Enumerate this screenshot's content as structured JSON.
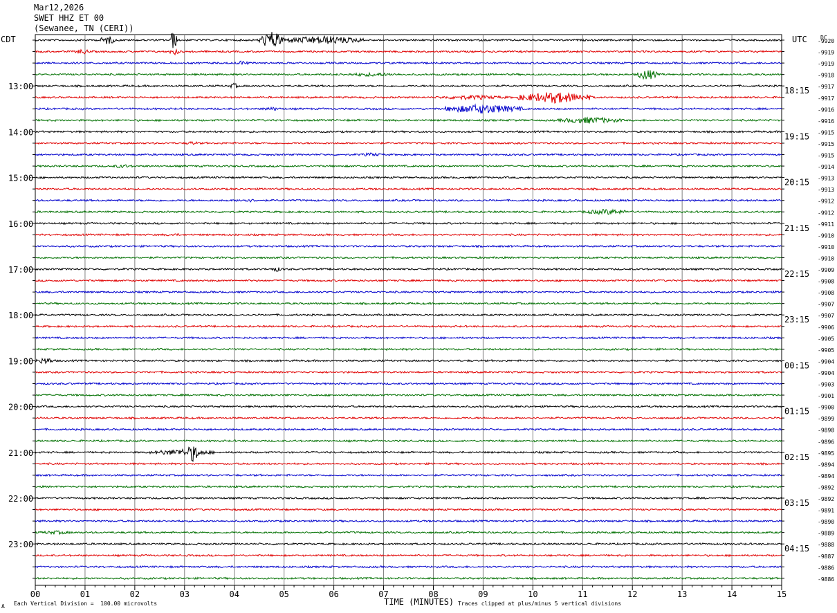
{
  "header": {
    "date": "Mar12,2026",
    "station": "SWET HHZ ET 00",
    "location": "(Sewanee, TN (CERI))"
  },
  "left_zone": "CDT",
  "right_zone": "UTC",
  "dc_label": "DC",
  "footer": {
    "scale_note": "Each Vertical Division =  100.00 microvolts",
    "clip_note": "Traces clipped at plus/minus 5 vertical divisions",
    "corner_mark": "A"
  },
  "colors": {
    "trace_cycle": [
      "#000000",
      "#e00000",
      "#0000cc",
      "#007000"
    ],
    "grid": "#808080"
  },
  "chart_data": {
    "type": "line",
    "title": "SWET HHZ ET 00",
    "xlabel": "TIME (MINUTES)",
    "ylabel": "",
    "xlim": [
      0,
      15
    ],
    "x_ticks": [
      "00",
      "01",
      "02",
      "03",
      "04",
      "05",
      "06",
      "07",
      "08",
      "09",
      "10",
      "11",
      "12",
      "13",
      "14",
      "15"
    ],
    "trace_count": 48,
    "left_hour_labels": [
      {
        "trace": 4,
        "label": "13:00"
      },
      {
        "trace": 8,
        "label": "14:00"
      },
      {
        "trace": 12,
        "label": "15:00"
      },
      {
        "trace": 16,
        "label": "16:00"
      },
      {
        "trace": 20,
        "label": "17:00"
      },
      {
        "trace": 24,
        "label": "18:00"
      },
      {
        "trace": 28,
        "label": "19:00"
      },
      {
        "trace": 32,
        "label": "20:00"
      },
      {
        "trace": 36,
        "label": "21:00"
      },
      {
        "trace": 40,
        "label": "22:00"
      },
      {
        "trace": 44,
        "label": "23:00"
      }
    ],
    "right_hour_labels": [
      {
        "trace": 4,
        "label": "18:15"
      },
      {
        "trace": 8,
        "label": "19:15"
      },
      {
        "trace": 12,
        "label": "20:15"
      },
      {
        "trace": 16,
        "label": "21:15"
      },
      {
        "trace": 20,
        "label": "22:15"
      },
      {
        "trace": 24,
        "label": "23:15"
      },
      {
        "trace": 28,
        "label": "00:15"
      },
      {
        "trace": 32,
        "label": "01:15"
      },
      {
        "trace": 36,
        "label": "02:15"
      },
      {
        "trace": 40,
        "label": "03:15"
      },
      {
        "trace": 44,
        "label": "04:15"
      }
    ],
    "dc_offsets": [
      "-9920",
      "-9919",
      "-9919",
      "-9918",
      "-9917",
      "-9917",
      "-9916",
      "-9916",
      "-9915",
      "-9915",
      "-9915",
      "-9914",
      "-9913",
      "-9913",
      "-9912",
      "-9912",
      "-9911",
      "-9910",
      "-9910",
      "-9910",
      "-9909",
      "-9908",
      "-9908",
      "-9907",
      "-9907",
      "-9906",
      "-9905",
      "-9905",
      "-9904",
      "-9904",
      "-9903",
      "-9901",
      "-9900",
      "-9899",
      "-9898",
      "-9896",
      "-9895",
      "-9894",
      "-9894",
      "-9892",
      "-9892",
      "-9891",
      "-9890",
      "-9889",
      "-9888",
      "-9887",
      "-9886",
      "-9886"
    ],
    "events": [
      {
        "trace": 0,
        "start_min": 1.3,
        "end_min": 1.6,
        "amp": 0.5
      },
      {
        "trace": 0,
        "start_min": 2.7,
        "end_min": 2.85,
        "amp": 1.0
      },
      {
        "trace": 0,
        "start_min": 4.5,
        "end_min": 5.0,
        "amp": 0.9
      },
      {
        "trace": 0,
        "start_min": 5.0,
        "end_min": 6.6,
        "amp": 0.45
      },
      {
        "trace": 1,
        "start_min": 0.8,
        "end_min": 1.1,
        "amp": 0.3
      },
      {
        "trace": 1,
        "start_min": 2.7,
        "end_min": 2.9,
        "amp": 0.4
      },
      {
        "trace": 2,
        "start_min": 4.0,
        "end_min": 4.3,
        "amp": 0.25
      },
      {
        "trace": 3,
        "start_min": 12.1,
        "end_min": 12.5,
        "amp": 0.6
      },
      {
        "trace": 3,
        "start_min": 6.0,
        "end_min": 7.5,
        "amp": 0.2
      },
      {
        "trace": 4,
        "start_min": 3.9,
        "end_min": 4.1,
        "amp": 0.3
      },
      {
        "trace": 5,
        "start_min": 8.0,
        "end_min": 9.5,
        "amp": 0.25
      },
      {
        "trace": 5,
        "start_min": 9.7,
        "end_min": 11.2,
        "amp": 0.6
      },
      {
        "trace": 6,
        "start_min": 8.2,
        "end_min": 9.8,
        "amp": 0.5
      },
      {
        "trace": 6,
        "start_min": 4.5,
        "end_min": 5.0,
        "amp": 0.2
      },
      {
        "trace": 7,
        "start_min": 10.5,
        "end_min": 11.8,
        "amp": 0.35
      },
      {
        "trace": 9,
        "start_min": 3.0,
        "end_min": 3.3,
        "amp": 0.2
      },
      {
        "trace": 10,
        "start_min": 6.5,
        "end_min": 7.0,
        "amp": 0.2
      },
      {
        "trace": 11,
        "start_min": 1.5,
        "end_min": 2.0,
        "amp": 0.2
      },
      {
        "trace": 14,
        "start_min": 4.0,
        "end_min": 4.5,
        "amp": 0.2
      },
      {
        "trace": 15,
        "start_min": 11.0,
        "end_min": 12.0,
        "amp": 0.3
      },
      {
        "trace": 17,
        "start_min": 2.5,
        "end_min": 3.0,
        "amp": 0.15
      },
      {
        "trace": 20,
        "start_min": 4.7,
        "end_min": 5.0,
        "amp": 0.25
      },
      {
        "trace": 28,
        "start_min": 0.0,
        "end_min": 0.4,
        "amp": 0.35
      },
      {
        "trace": 36,
        "start_min": 2.3,
        "end_min": 3.6,
        "amp": 0.35
      },
      {
        "trace": 36,
        "start_min": 3.05,
        "end_min": 3.3,
        "amp": 1.0
      },
      {
        "trace": 43,
        "start_min": 0.0,
        "end_min": 0.8,
        "amp": 0.2
      }
    ]
  }
}
